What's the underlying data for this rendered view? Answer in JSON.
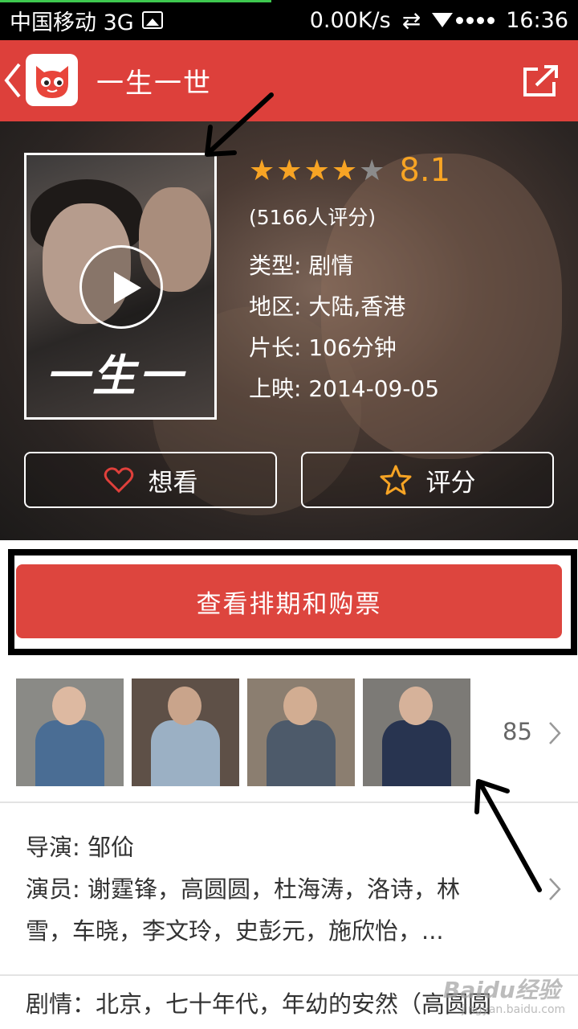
{
  "status_bar": {
    "carrier": "中国移动 3G",
    "speed": "0.00K/s",
    "time": "16:36",
    "icons": [
      "image-icon",
      "sync-icon",
      "wifi-icon",
      "signal-icon"
    ]
  },
  "header": {
    "title": "一生一世",
    "back_icon": "chevron-left-icon",
    "logo_icon": "cat-logo-icon",
    "share_icon": "share-icon"
  },
  "movie": {
    "stars_full": 4,
    "stars_total": 5,
    "score": "8.1",
    "votes": "(5166人评分)",
    "genre": "类型: 剧情",
    "region": "地区: 大陆,香港",
    "duration": "片长: 106分钟",
    "release": "上映: 2014-09-05",
    "poster_title": "一生一世"
  },
  "actions": {
    "want_label": "想看",
    "rate_label": "评分"
  },
  "buy": {
    "label": "查看排期和购票"
  },
  "photos": {
    "count": "85"
  },
  "crew": {
    "director": "导演: 邹佡",
    "actors_line1": "演员: 谢霆锋，高圆圆，杜海涛，洛诗，林",
    "actors_line2": "雪，车晓，李文玲，史彭元，施欣怡，..."
  },
  "plot": {
    "text": "剧情：北京，七十年代，年幼的安然（高圆圆"
  },
  "watermark": {
    "brand": "Baidu经验",
    "url": "jingyan.baidu.com"
  },
  "colors": {
    "brand_red": "#dd403b",
    "star": "#f7a424"
  }
}
